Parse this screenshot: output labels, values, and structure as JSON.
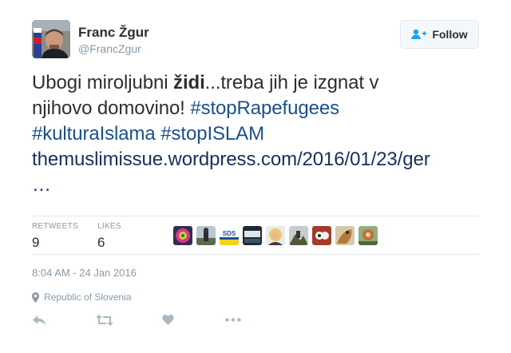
{
  "user": {
    "name": "Franc Žgur",
    "handle": "@FrancZgur",
    "avatar": "profile-photo"
  },
  "follow_button": {
    "label": "Follow",
    "icon": "add-user-icon"
  },
  "tweet": {
    "line1_pre": "Ubogi miroljubni ",
    "line1_bold": "židi",
    "line1_post": "...treba jih je izgnat v",
    "line2_pre": "njihovo domovino! ",
    "hashtag1": "#stopRapefugees",
    "hashtag2": "#kulturaIslama",
    "hashtag3": "#stopISLAM",
    "link": "themuslimissue.wordpress.com/2016/01/23/ger",
    "ellipsis": "…"
  },
  "stats": {
    "retweets_label": "RETWEETS",
    "retweets_value": "9",
    "likes_label": "LIKES",
    "likes_value": "6"
  },
  "likers": [
    "avatar-1",
    "avatar-2",
    "avatar-sds",
    "avatar-4",
    "avatar-5",
    "avatar-6",
    "avatar-7",
    "avatar-8",
    "avatar-9"
  ],
  "sds_text": "SDS",
  "timestamp": "8:04 AM - 24 Jan 2016",
  "location": {
    "icon": "location-pin-icon",
    "label": "Republic of Slovenia"
  },
  "actions": [
    "reply-icon",
    "retweet-icon",
    "like-icon",
    "more-icon"
  ],
  "colors": {
    "hashtag": "#1b4f8a",
    "muted": "#8899a6",
    "text": "#292f33",
    "border": "#e1e8ed"
  }
}
